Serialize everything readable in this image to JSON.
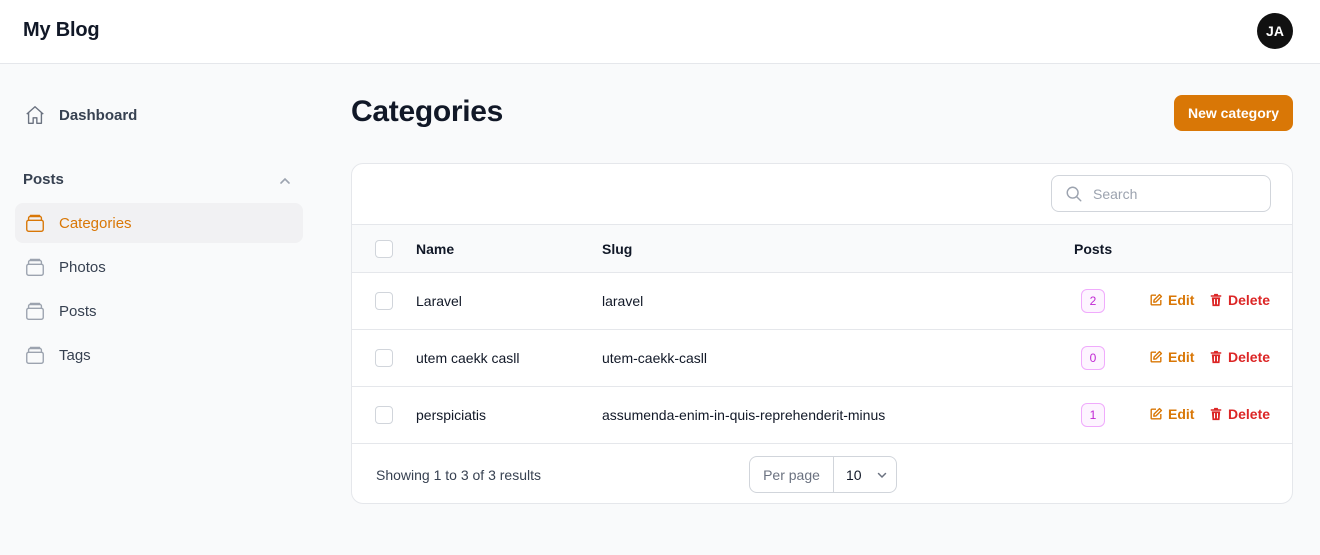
{
  "app": {
    "title": "My Blog",
    "user_initials": "JA"
  },
  "sidebar": {
    "dashboard": {
      "label": "Dashboard",
      "icon": "home-icon"
    },
    "group": {
      "label": "Posts",
      "expanded": true
    },
    "items": [
      {
        "label": "Categories",
        "icon": "folder-icon",
        "active": true
      },
      {
        "label": "Photos",
        "icon": "folder-icon",
        "active": false
      },
      {
        "label": "Posts",
        "icon": "folder-icon",
        "active": false
      },
      {
        "label": "Tags",
        "icon": "folder-icon",
        "active": false
      }
    ]
  },
  "page": {
    "title": "Categories",
    "new_button_label": "New category"
  },
  "table": {
    "search_placeholder": "Search",
    "columns": {
      "name": "Name",
      "slug": "Slug",
      "posts": "Posts"
    },
    "rows": [
      {
        "name": "Laravel",
        "slug": "laravel",
        "posts": "2"
      },
      {
        "name": "utem caekk casll",
        "slug": "utem-caekk-casll",
        "posts": "0"
      },
      {
        "name": "perspiciatis",
        "slug": "assumenda-enim-in-quis-reprehenderit-minus",
        "posts": "1"
      }
    ],
    "actions": {
      "edit": "Edit",
      "delete": "Delete"
    },
    "footer": {
      "summary": "Showing 1 to 3 of 3 results",
      "per_page_label": "Per page",
      "per_page_value": "10"
    }
  },
  "colors": {
    "accent": "#d97706",
    "danger": "#dc2626",
    "badge": "#c026d3"
  }
}
